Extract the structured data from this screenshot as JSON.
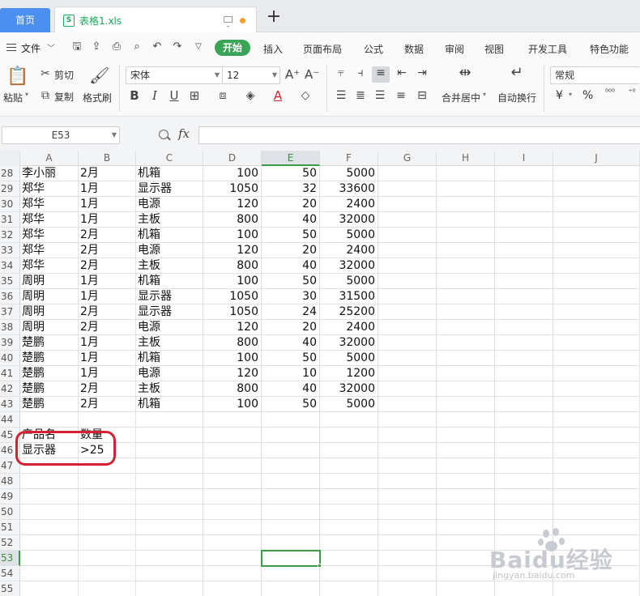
{
  "tabs": {
    "home": "首页",
    "file": "表格1.xls",
    "new_tab": "+"
  },
  "menubar": {
    "file": "文件",
    "items": [
      "开始",
      "插入",
      "页面布局",
      "公式",
      "数据",
      "审阅",
      "视图",
      "开发工具",
      "特色功能"
    ]
  },
  "toolbar": {
    "paste": "粘贴",
    "cut": "剪切",
    "copy": "复制",
    "format_painter": "格式刷",
    "font_name": "宋体",
    "font_size": "12",
    "merge_center": "合并居中",
    "wrap_text": "自动换行",
    "number_format": "常规",
    "currency": "¥",
    "percent": "%"
  },
  "formula_bar": {
    "cell_ref": "E53",
    "fx": "fx",
    "formula": ""
  },
  "grid": {
    "columns": [
      "A",
      "B",
      "C",
      "D",
      "E",
      "F",
      "G",
      "H",
      "I",
      "J"
    ],
    "selected_column": "E",
    "selected_row": "53",
    "rows": [
      {
        "num": "28",
        "a": "李小丽",
        "b": "2月",
        "c": "机箱",
        "d": "100",
        "e": "50",
        "f": "5000"
      },
      {
        "num": "29",
        "a": "郑华",
        "b": "1月",
        "c": "显示器",
        "d": "1050",
        "e": "32",
        "f": "33600"
      },
      {
        "num": "30",
        "a": "郑华",
        "b": "1月",
        "c": "电源",
        "d": "120",
        "e": "20",
        "f": "2400"
      },
      {
        "num": "31",
        "a": "郑华",
        "b": "1月",
        "c": "主板",
        "d": "800",
        "e": "40",
        "f": "32000"
      },
      {
        "num": "32",
        "a": "郑华",
        "b": "2月",
        "c": "机箱",
        "d": "100",
        "e": "50",
        "f": "5000"
      },
      {
        "num": "33",
        "a": "郑华",
        "b": "2月",
        "c": "电源",
        "d": "120",
        "e": "20",
        "f": "2400"
      },
      {
        "num": "34",
        "a": "郑华",
        "b": "2月",
        "c": "主板",
        "d": "800",
        "e": "40",
        "f": "32000"
      },
      {
        "num": "35",
        "a": "周明",
        "b": "1月",
        "c": "机箱",
        "d": "100",
        "e": "50",
        "f": "5000"
      },
      {
        "num": "36",
        "a": "周明",
        "b": "1月",
        "c": "显示器",
        "d": "1050",
        "e": "30",
        "f": "31500"
      },
      {
        "num": "37",
        "a": "周明",
        "b": "2月",
        "c": "显示器",
        "d": "1050",
        "e": "24",
        "f": "25200"
      },
      {
        "num": "38",
        "a": "周明",
        "b": "2月",
        "c": "电源",
        "d": "120",
        "e": "20",
        "f": "2400"
      },
      {
        "num": "39",
        "a": "楚鹏",
        "b": "1月",
        "c": "主板",
        "d": "800",
        "e": "40",
        "f": "32000"
      },
      {
        "num": "40",
        "a": "楚鹏",
        "b": "1月",
        "c": "机箱",
        "d": "100",
        "e": "50",
        "f": "5000"
      },
      {
        "num": "41",
        "a": "楚鹏",
        "b": "1月",
        "c": "电源",
        "d": "120",
        "e": "10",
        "f": "1200"
      },
      {
        "num": "42",
        "a": "楚鹏",
        "b": "2月",
        "c": "主板",
        "d": "800",
        "e": "40",
        "f": "32000"
      },
      {
        "num": "43",
        "a": "楚鹏",
        "b": "2月",
        "c": "机箱",
        "d": "100",
        "e": "50",
        "f": "5000"
      },
      {
        "num": "44",
        "a": "",
        "b": "",
        "c": "",
        "d": "",
        "e": "",
        "f": ""
      },
      {
        "num": "45",
        "a": "产品名",
        "b": "数量",
        "c": "",
        "d": "",
        "e": "",
        "f": ""
      },
      {
        "num": "46",
        "a": "显示器",
        "b": ">25",
        "c": "",
        "d": "",
        "e": "",
        "f": ""
      },
      {
        "num": "47",
        "a": "",
        "b": "",
        "c": "",
        "d": "",
        "e": "",
        "f": ""
      },
      {
        "num": "48",
        "a": "",
        "b": "",
        "c": "",
        "d": "",
        "e": "",
        "f": ""
      },
      {
        "num": "49",
        "a": "",
        "b": "",
        "c": "",
        "d": "",
        "e": "",
        "f": ""
      },
      {
        "num": "50",
        "a": "",
        "b": "",
        "c": "",
        "d": "",
        "e": "",
        "f": ""
      },
      {
        "num": "51",
        "a": "",
        "b": "",
        "c": "",
        "d": "",
        "e": "",
        "f": ""
      },
      {
        "num": "52",
        "a": "",
        "b": "",
        "c": "",
        "d": "",
        "e": "",
        "f": ""
      },
      {
        "num": "53",
        "a": "",
        "b": "",
        "c": "",
        "d": "",
        "e": "",
        "f": ""
      },
      {
        "num": "54",
        "a": "",
        "b": "",
        "c": "",
        "d": "",
        "e": "",
        "f": ""
      },
      {
        "num": "55",
        "a": "",
        "b": "",
        "c": "",
        "d": "",
        "e": "",
        "f": ""
      }
    ]
  },
  "watermark": {
    "brand": "Baidu经验",
    "url": "jingyan.baidu.com"
  },
  "colors": {
    "accent_green": "#3a9c47",
    "start_button": "#3aa556",
    "home_tab": "#4b8ff0",
    "annotation_red": "#d42230"
  }
}
